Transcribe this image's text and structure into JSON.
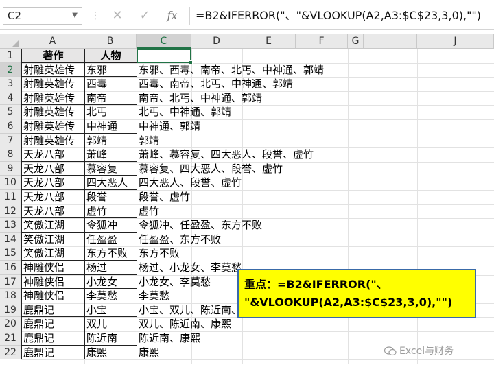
{
  "formula_bar": {
    "name_box": "C2",
    "cancel_icon": "✕",
    "enter_icon": "✓",
    "fx_label": "fx",
    "formula": "=B2&IFERROR(\"、\"&VLOOKUP(A2,A3:$C$23,3,0),\"\")"
  },
  "columns": [
    "A",
    "B",
    "C",
    "D",
    "E",
    "F",
    "G",
    "J",
    "K"
  ],
  "header_row": {
    "a": "著作",
    "b": "人物",
    "c": ""
  },
  "rows": [
    {
      "n": "2",
      "a": "射雕英雄传",
      "b": "东邪",
      "c": "东邪、西毒、南帝、北丐、中神通、郭靖"
    },
    {
      "n": "3",
      "a": "射雕英雄传",
      "b": "西毒",
      "c": "西毒、南帝、北丐、中神通、郭靖"
    },
    {
      "n": "4",
      "a": "射雕英雄传",
      "b": "南帝",
      "c": "南帝、北丐、中神通、郭靖"
    },
    {
      "n": "5",
      "a": "射雕英雄传",
      "b": "北丐",
      "c": "北丐、中神通、郭靖"
    },
    {
      "n": "6",
      "a": "射雕英雄传",
      "b": "中神通",
      "c": "中神通、郭靖"
    },
    {
      "n": "7",
      "a": "射雕英雄传",
      "b": "郭靖",
      "c": "郭靖"
    },
    {
      "n": "8",
      "a": "天龙八部",
      "b": "萧峰",
      "c": "萧峰、慕容复、四大恶人、段誉、虚竹"
    },
    {
      "n": "9",
      "a": "天龙八部",
      "b": "慕容复",
      "c": "慕容复、四大恶人、段誉、虚竹"
    },
    {
      "n": "10",
      "a": "天龙八部",
      "b": "四大恶人",
      "c": "四大恶人、段誉、虚竹"
    },
    {
      "n": "11",
      "a": "天龙八部",
      "b": "段誉",
      "c": "段誉、虚竹"
    },
    {
      "n": "12",
      "a": "天龙八部",
      "b": "虚竹",
      "c": "虚竹"
    },
    {
      "n": "13",
      "a": "笑傲江湖",
      "b": "令狐冲",
      "c": "令狐冲、任盈盈、东方不败"
    },
    {
      "n": "14",
      "a": "笑傲江湖",
      "b": "任盈盈",
      "c": "任盈盈、东方不败"
    },
    {
      "n": "15",
      "a": "笑傲江湖",
      "b": "东方不败",
      "c": "东方不败"
    },
    {
      "n": "16",
      "a": "神雕侠侣",
      "b": "杨过",
      "c": "杨过、小龙女、李莫愁"
    },
    {
      "n": "17",
      "a": "神雕侠侣",
      "b": "小龙女",
      "c": "小龙女、李莫愁"
    },
    {
      "n": "18",
      "a": "神雕侠侣",
      "b": "李莫愁",
      "c": "李莫愁"
    },
    {
      "n": "19",
      "a": "鹿鼎记",
      "b": "小宝",
      "c": "小宝、双儿、陈近南、康熙"
    },
    {
      "n": "20",
      "a": "鹿鼎记",
      "b": "双儿",
      "c": "双儿、陈近南、康熙"
    },
    {
      "n": "21",
      "a": "鹿鼎记",
      "b": "陈近南",
      "c": "陈近南、康熙"
    },
    {
      "n": "22",
      "a": "鹿鼎记",
      "b": "康熙",
      "c": "康熙"
    }
  ],
  "callout": {
    "line1": "重点：=B2&IFERROR(\"、",
    "line2": "\"&VLOOKUP(A2,A3:$C$23,3,0),\"\")"
  },
  "watermark": "Excel与财务"
}
